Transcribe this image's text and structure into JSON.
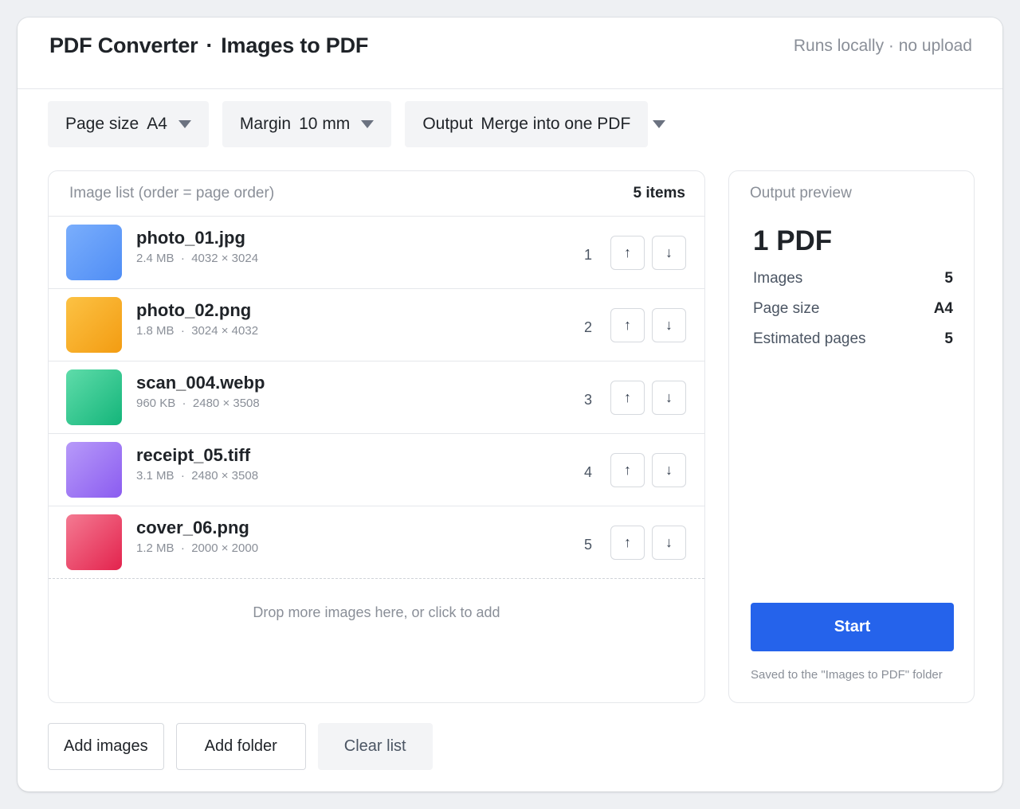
{
  "header": {
    "app": "PDF Converter",
    "separator": "·",
    "mode": "Images to PDF",
    "note": "Runs locally · no upload"
  },
  "toolbar": {
    "page_size": {
      "label": "Page size",
      "value": "A4"
    },
    "margin": {
      "label": "Margin",
      "value": "10 mm"
    },
    "output": {
      "label": "Output",
      "value": "Merge into one PDF"
    }
  },
  "list": {
    "hint": "Image list (order = page order)",
    "count": "5 items",
    "items": [
      {
        "name": "photo_01.jpg",
        "size": "2.4 MB",
        "dims": "4032 × 3024",
        "order": "1",
        "color_from": "#7aaefc",
        "color_to": "#4f8df5"
      },
      {
        "name": "photo_02.png",
        "size": "1.8 MB",
        "dims": "3024 × 4032",
        "order": "2",
        "color_from": "#fcc244",
        "color_to": "#f39c12"
      },
      {
        "name": "scan_004.webp",
        "size": "960 KB",
        "dims": "2480 × 3508",
        "order": "3",
        "color_from": "#5fdcaa",
        "color_to": "#14b57a"
      },
      {
        "name": "receipt_05.tiff",
        "size": "3.1 MB",
        "dims": "2480 × 3508",
        "order": "4",
        "color_from": "#b79af9",
        "color_to": "#8b5cf0"
      },
      {
        "name": "cover_06.png",
        "size": "1.2 MB",
        "dims": "2000 × 2000",
        "order": "5",
        "color_from": "#f47a92",
        "color_to": "#e3234d"
      }
    ],
    "up_glyph": "↑",
    "down_glyph": "↓",
    "dropzone": "Drop more images here, or click to add"
  },
  "preview": {
    "title": "Output preview",
    "result": "1 PDF",
    "stats": [
      {
        "key": "Images",
        "value": "5"
      },
      {
        "key": "Page size",
        "value": "A4"
      },
      {
        "key": "Estimated pages",
        "value": "5"
      }
    ],
    "start": "Start",
    "saved": "Saved to the \"Images to PDF\" folder",
    "accent": "#2563eb"
  },
  "footer": {
    "add_images": "Add images",
    "add_folder": "Add folder",
    "clear_list": "Clear list"
  }
}
